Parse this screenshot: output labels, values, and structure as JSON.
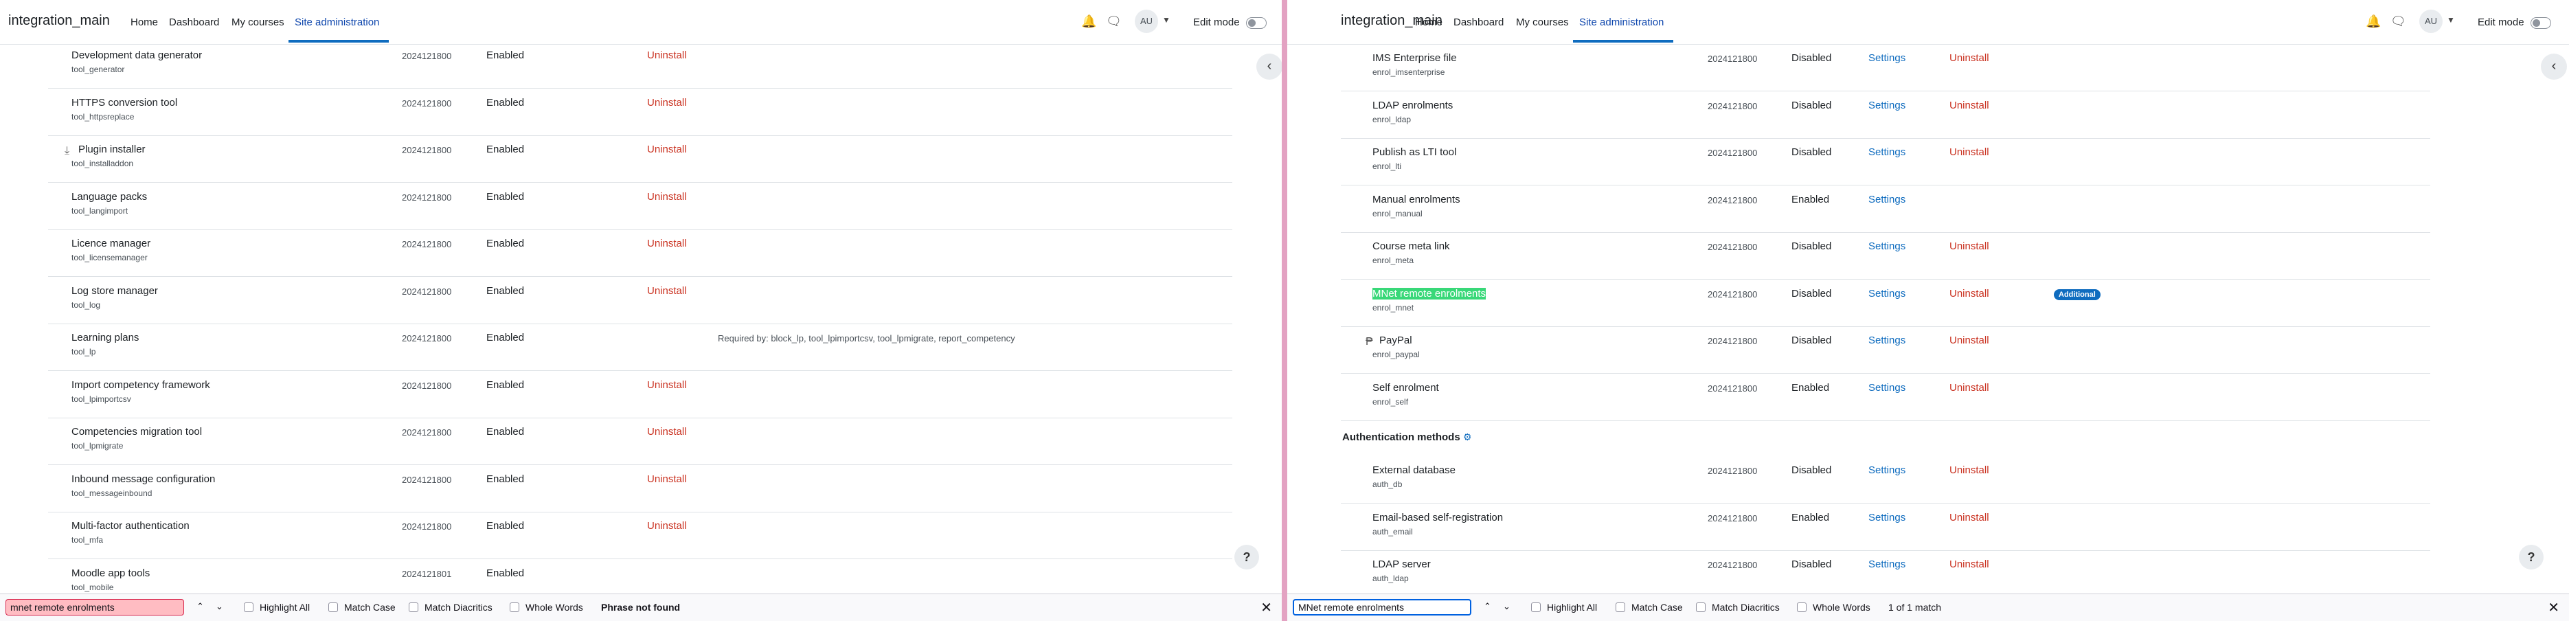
{
  "left": {
    "nav": {
      "site_name": "integration_main",
      "items": [
        "Home",
        "Dashboard",
        "My courses",
        "Site administration"
      ],
      "avatar": "AU",
      "edit_mode": "Edit mode"
    },
    "rows": [
      {
        "name": "Development data generator",
        "component": "tool_generator",
        "version": "2024121800",
        "status": "Enabled",
        "uninstall": "Uninstall"
      },
      {
        "name": "HTTPS conversion tool",
        "component": "tool_httpsreplace",
        "version": "2024121800",
        "status": "Enabled",
        "uninstall": "Uninstall"
      },
      {
        "name": "Plugin installer",
        "component": "tool_installaddon",
        "version": "2024121800",
        "status": "Enabled",
        "uninstall": "Uninstall"
      },
      {
        "name": "Language packs",
        "component": "tool_langimport",
        "version": "2024121800",
        "status": "Enabled",
        "uninstall": "Uninstall"
      },
      {
        "name": "Licence manager",
        "component": "tool_licensemanager",
        "version": "2024121800",
        "status": "Enabled",
        "uninstall": "Uninstall"
      },
      {
        "name": "Log store manager",
        "component": "tool_log",
        "version": "2024121800",
        "status": "Enabled",
        "uninstall": "Uninstall"
      },
      {
        "name": "Learning plans",
        "component": "tool_lp",
        "version": "2024121800",
        "status": "Enabled",
        "required": "Required by: block_lp, tool_lpimportcsv, tool_lpmigrate, report_competency"
      },
      {
        "name": "Import competency framework",
        "component": "tool_lpimportcsv",
        "version": "2024121800",
        "status": "Enabled",
        "uninstall": "Uninstall"
      },
      {
        "name": "Competencies migration tool",
        "component": "tool_lpmigrate",
        "version": "2024121800",
        "status": "Enabled",
        "uninstall": "Uninstall"
      },
      {
        "name": "Inbound message configuration",
        "component": "tool_messageinbound",
        "version": "2024121800",
        "status": "Enabled",
        "uninstall": "Uninstall"
      },
      {
        "name": "Multi-factor authentication",
        "component": "tool_mfa",
        "version": "2024121800",
        "status": "Enabled",
        "uninstall": "Uninstall"
      },
      {
        "name": "Moodle app tools",
        "component": "tool_mobile",
        "version": "2024121801",
        "status": "Enabled"
      }
    ],
    "find": {
      "query": "mnet remote enrolments",
      "highlight_all": "Highlight All",
      "match_case": "Match Case",
      "match_diacritics": "Match Diacritics",
      "whole_words": "Whole Words",
      "status": "Phrase not found"
    }
  },
  "right": {
    "nav": {
      "site_name": "integration_main",
      "items": [
        "Home",
        "Dashboard",
        "My courses",
        "Site administration"
      ],
      "avatar": "AU",
      "edit_mode": "Edit mode"
    },
    "rows": [
      {
        "name": "IMS Enterprise file",
        "component": "enrol_imsenterprise",
        "version": "2024121800",
        "status": "Disabled",
        "settings": "Settings",
        "uninstall": "Uninstall"
      },
      {
        "name": "LDAP enrolments",
        "component": "enrol_ldap",
        "version": "2024121800",
        "status": "Disabled",
        "settings": "Settings",
        "uninstall": "Uninstall"
      },
      {
        "name": "Publish as LTI tool",
        "component": "enrol_lti",
        "version": "2024121800",
        "status": "Disabled",
        "settings": "Settings",
        "uninstall": "Uninstall"
      },
      {
        "name": "Manual enrolments",
        "component": "enrol_manual",
        "version": "2024121800",
        "status": "Enabled",
        "settings": "Settings"
      },
      {
        "name": "Course meta link",
        "component": "enrol_meta",
        "version": "2024121800",
        "status": "Disabled",
        "settings": "Settings",
        "uninstall": "Uninstall"
      },
      {
        "name": "MNet remote enrolments",
        "component": "enrol_mnet",
        "version": "2024121800",
        "status": "Disabled",
        "settings": "Settings",
        "uninstall": "Uninstall",
        "badge": "Additional"
      },
      {
        "name": "PayPal",
        "component": "enrol_paypal",
        "version": "2024121800",
        "status": "Disabled",
        "settings": "Settings",
        "uninstall": "Uninstall"
      },
      {
        "name": "Self enrolment",
        "component": "enrol_self",
        "version": "2024121800",
        "status": "Enabled",
        "settings": "Settings",
        "uninstall": "Uninstall"
      }
    ],
    "section_heading": "Authentication methods",
    "auth_rows": [
      {
        "name": "External database",
        "component": "auth_db",
        "version": "2024121800",
        "status": "Disabled",
        "settings": "Settings",
        "uninstall": "Uninstall"
      },
      {
        "name": "Email-based self-registration",
        "component": "auth_email",
        "version": "2024121800",
        "status": "Enabled",
        "settings": "Settings",
        "uninstall": "Uninstall"
      },
      {
        "name": "LDAP server",
        "component": "auth_ldap",
        "version": "2024121800",
        "status": "Disabled",
        "settings": "Settings",
        "uninstall": "Uninstall"
      }
    ],
    "find": {
      "query": "MNet remote enrolments",
      "highlight_all": "Highlight All",
      "match_case": "Match Case",
      "match_diacritics": "Match Diacritics",
      "whole_words": "Whole Words",
      "status": "1 of 1 match"
    }
  },
  "colors": {
    "accent": "#0f6cbf",
    "uninstall": "#ca3120",
    "highlight": "#38d878",
    "notfound": "#ffbcc2"
  }
}
